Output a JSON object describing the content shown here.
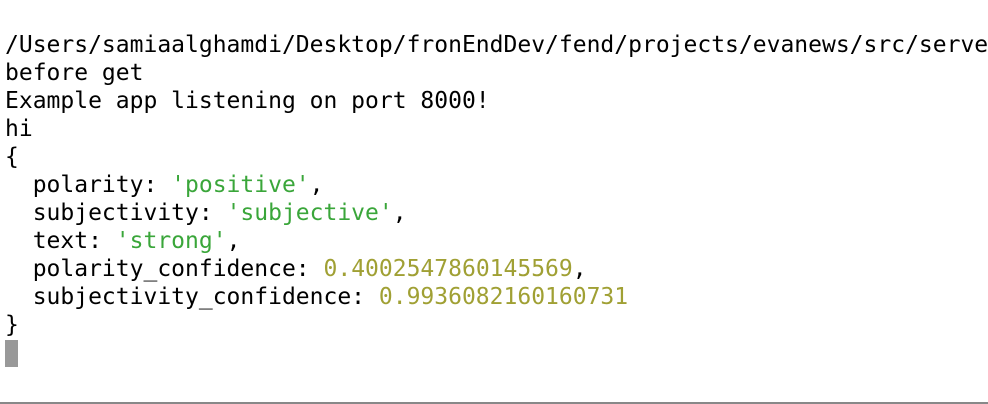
{
  "terminal": {
    "path_line": "/Users/samiaalghamdi/Desktop/fronEndDev/fend/projects/evanews/src/server",
    "line2": "before get",
    "line3": "Example app listening on port 8000!",
    "line4": "hi",
    "open_brace": "{",
    "close_brace": "}",
    "fields": [
      {
        "key": "  polarity: ",
        "value": "'positive'",
        "suffix": ",",
        "type": "string"
      },
      {
        "key": "  subjectivity: ",
        "value": "'subjective'",
        "suffix": ",",
        "type": "string"
      },
      {
        "key": "  text: ",
        "value": "'strong'",
        "suffix": ",",
        "type": "string"
      },
      {
        "key": "  polarity_confidence: ",
        "value": "0.4002547860145569",
        "suffix": ",",
        "type": "number"
      },
      {
        "key": "  subjectivity_confidence: ",
        "value": "0.9936082160160731",
        "suffix": "",
        "type": "number"
      }
    ],
    "colors": {
      "string": "#3aa63a",
      "number": "#a0a034",
      "cursor": "#999999"
    }
  }
}
